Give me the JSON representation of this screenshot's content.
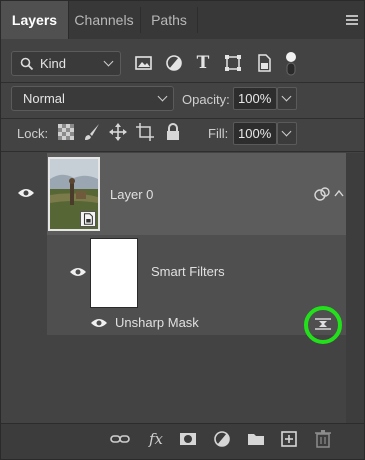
{
  "tabs": [
    {
      "label": "Layers",
      "active": true
    },
    {
      "label": "Channels",
      "active": false
    },
    {
      "label": "Paths",
      "active": false
    }
  ],
  "filter": {
    "kind_label": "Kind",
    "icons": [
      "image-filter-icon",
      "adjustment-filter-icon",
      "type-filter-icon",
      "shape-filter-icon",
      "smart-object-filter-icon",
      "filter-toggle-icon"
    ]
  },
  "blend": {
    "mode": "Normal",
    "opacity_label": "Opacity:",
    "opacity_value": "100%"
  },
  "lock": {
    "label": "Lock:",
    "icons": [
      "lock-transparent-icon",
      "lock-paint-icon",
      "lock-position-icon",
      "lock-artboard-icon",
      "lock-all-icon"
    ],
    "fill_label": "Fill:",
    "fill_value": "100%"
  },
  "layers": [
    {
      "name": "Layer 0",
      "type": "smart-object",
      "visible": true,
      "selected": true
    }
  ],
  "smart_filters": {
    "label": "Smart Filters",
    "items": [
      {
        "name": "Unsharp Mask",
        "visible": true
      }
    ]
  },
  "colors": {
    "highlight_ring": "#22e01a",
    "selected_row": "#5c5c5c",
    "panel_bg": "#434343"
  },
  "bottom_icons": [
    "link-layers-icon",
    "fx-icon",
    "layer-mask-icon",
    "adjustment-layer-icon",
    "group-folder-icon",
    "new-layer-icon",
    "delete-layer-icon"
  ]
}
